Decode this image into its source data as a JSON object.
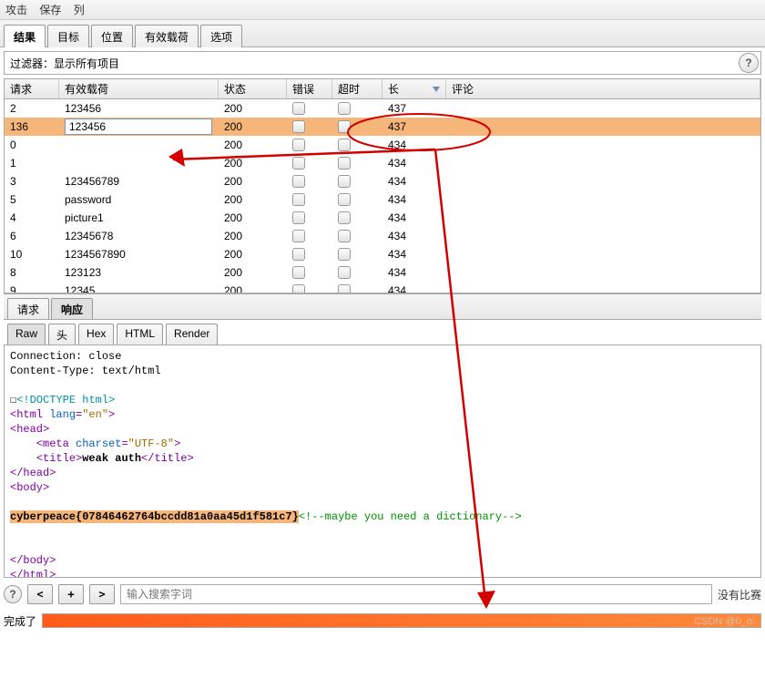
{
  "menu": {
    "items": [
      "攻击",
      "保存",
      "列"
    ]
  },
  "main_tabs": {
    "items": [
      "结果",
      "目标",
      "位置",
      "有效载荷",
      "选项"
    ],
    "active": 0
  },
  "filter": {
    "label": "过滤器：显示所有项目"
  },
  "table": {
    "columns": [
      "请求",
      "有效载荷",
      "状态",
      "错误",
      "超时",
      "长",
      "评论"
    ],
    "sort_col": 5,
    "rows": [
      {
        "req": "2",
        "payload": "123456",
        "status": "200",
        "len": "437",
        "sel": false
      },
      {
        "req": "136",
        "payload": "123456",
        "status": "200",
        "len": "437",
        "sel": true
      },
      {
        "req": "0",
        "payload": "",
        "status": "200",
        "len": "434",
        "sel": false
      },
      {
        "req": "1",
        "payload": "",
        "status": "200",
        "len": "434",
        "sel": false
      },
      {
        "req": "3",
        "payload": "123456789",
        "status": "200",
        "len": "434",
        "sel": false
      },
      {
        "req": "5",
        "payload": "password",
        "status": "200",
        "len": "434",
        "sel": false
      },
      {
        "req": "4",
        "payload": "picture1",
        "status": "200",
        "len": "434",
        "sel": false
      },
      {
        "req": "6",
        "payload": "12345678",
        "status": "200",
        "len": "434",
        "sel": false
      },
      {
        "req": "10",
        "payload": "1234567890",
        "status": "200",
        "len": "434",
        "sel": false
      },
      {
        "req": "8",
        "payload": "123123",
        "status": "200",
        "len": "434",
        "sel": false
      },
      {
        "req": "9",
        "payload": "12345",
        "status": "200",
        "len": "434",
        "sel": false
      }
    ]
  },
  "sub_tabs": {
    "items": [
      "请求",
      "响应"
    ],
    "active": 1
  },
  "view_tabs": {
    "items": [
      "Raw",
      "头",
      "Hex",
      "HTML",
      "Render"
    ],
    "active": 0
  },
  "raw_headers": {
    "line1": "Connection: close",
    "line2": "Content-Type: text/html"
  },
  "raw_body": {
    "doctype_box": "☐",
    "doctype": "<!DOCTYPE html>",
    "html_open_name": "html",
    "html_attr": "lang",
    "html_attr_val": "\"en\"",
    "head_open": "head",
    "meta_name": "meta",
    "meta_attr": "charset",
    "meta_val": "\"UTF-8\"",
    "title_open": "title",
    "title_text": "weak auth",
    "title_close": "title",
    "head_close": "head",
    "body_open": "body",
    "flag": "cyberpeace{07846462764bccdd81a0aa45d1f581c7}",
    "comment": "<!--maybe you need a dictionary-->",
    "body_close": "body",
    "html_close": "html"
  },
  "search": {
    "prev": "<",
    "plus": "+",
    "next": ">",
    "placeholder": "输入搜索字词",
    "status": "没有比赛"
  },
  "status": {
    "label": "完成了",
    "watermark": "CSDN @0_o:"
  }
}
